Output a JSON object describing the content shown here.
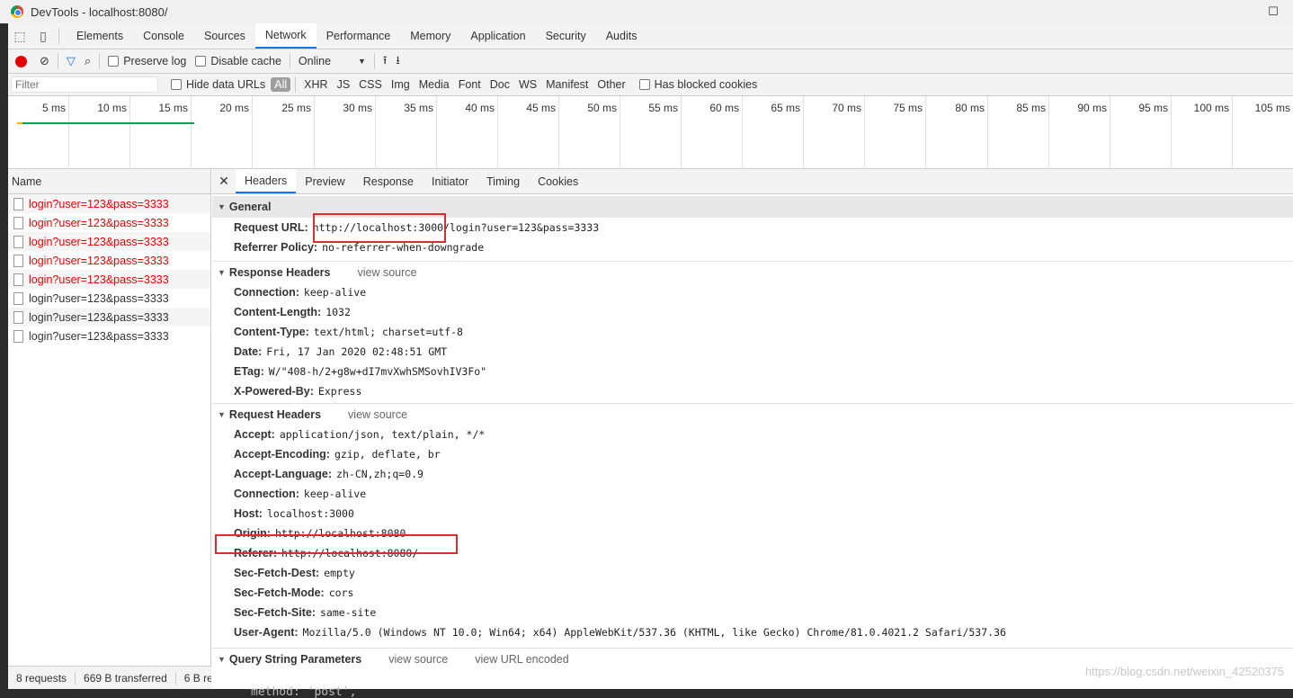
{
  "window": {
    "title": "DevTools - localhost:8080/",
    "maximize": "☐"
  },
  "main_tabs": [
    "Elements",
    "Console",
    "Sources",
    "Network",
    "Performance",
    "Memory",
    "Application",
    "Security",
    "Audits"
  ],
  "toolbar": {
    "preserve_log": "Preserve log",
    "disable_cache": "Disable cache",
    "throttle": "Online"
  },
  "filter_bar": {
    "placeholder": "Filter",
    "hide_data_urls": "Hide data URLs",
    "types": [
      "All",
      "XHR",
      "JS",
      "CSS",
      "Img",
      "Media",
      "Font",
      "Doc",
      "WS",
      "Manifest",
      "Other"
    ],
    "has_blocked_cookies": "Has blocked cookies"
  },
  "overview": {
    "ticks": [
      "5 ms",
      "10 ms",
      "15 ms",
      "20 ms",
      "25 ms",
      "30 ms",
      "35 ms",
      "40 ms",
      "45 ms",
      "50 ms",
      "55 ms",
      "60 ms",
      "65 ms",
      "70 ms",
      "75 ms",
      "80 ms",
      "85 ms",
      "90 ms",
      "95 ms",
      "100 ms",
      "105 ms"
    ]
  },
  "request_list": {
    "header": "Name",
    "rows": [
      {
        "name": "login?user=123&pass=3333",
        "failed": true
      },
      {
        "name": "login?user=123&pass=3333",
        "failed": true
      },
      {
        "name": "login?user=123&pass=3333",
        "failed": true
      },
      {
        "name": "login?user=123&pass=3333",
        "failed": true
      },
      {
        "name": "login?user=123&pass=3333",
        "failed": true
      },
      {
        "name": "login?user=123&pass=3333",
        "failed": false
      },
      {
        "name": "login?user=123&pass=3333",
        "failed": false
      },
      {
        "name": "login?user=123&pass=3333",
        "failed": false
      }
    ],
    "status": {
      "requests": "8 requests",
      "transferred": "669 B transferred",
      "resources": "6 B re"
    }
  },
  "detail_tabs": [
    "Headers",
    "Preview",
    "Response",
    "Initiator",
    "Timing",
    "Cookies"
  ],
  "general": {
    "title": "General",
    "rows": [
      {
        "k": "Request URL:",
        "v": "http://localhost:3000/login?user=123&pass=3333"
      },
      {
        "k": "Referrer Policy:",
        "v": "no-referrer-when-downgrade"
      }
    ]
  },
  "response_headers": {
    "title": "Response Headers",
    "view_source": "view source",
    "rows": [
      {
        "k": "Connection:",
        "v": "keep-alive"
      },
      {
        "k": "Content-Length:",
        "v": "1032"
      },
      {
        "k": "Content-Type:",
        "v": "text/html; charset=utf-8"
      },
      {
        "k": "Date:",
        "v": "Fri, 17 Jan 2020 02:48:51 GMT"
      },
      {
        "k": "ETag:",
        "v": "W/\"408-h/2+g8w+dI7mvXwhSMSovhIV3Fo\""
      },
      {
        "k": "X-Powered-By:",
        "v": "Express"
      }
    ]
  },
  "request_headers": {
    "title": "Request Headers",
    "view_source": "view source",
    "rows": [
      {
        "k": "Accept:",
        "v": "application/json, text/plain, */*"
      },
      {
        "k": "Accept-Encoding:",
        "v": "gzip, deflate, br"
      },
      {
        "k": "Accept-Language:",
        "v": "zh-CN,zh;q=0.9"
      },
      {
        "k": "Connection:",
        "v": "keep-alive"
      },
      {
        "k": "Host:",
        "v": "localhost:3000"
      },
      {
        "k": "Origin:",
        "v": "http://localhost:8080"
      },
      {
        "k": "Referer:",
        "v": "http://localhost:8080/"
      },
      {
        "k": "Sec-Fetch-Dest:",
        "v": "empty"
      },
      {
        "k": "Sec-Fetch-Mode:",
        "v": "cors"
      },
      {
        "k": "Sec-Fetch-Site:",
        "v": "same-site"
      },
      {
        "k": "User-Agent:",
        "v": "Mozilla/5.0 (Windows NT 10.0; Win64; x64) AppleWebKit/537.36 (KHTML, like Gecko) Chrome/81.0.4021.2 Safari/537.36"
      }
    ]
  },
  "query_string": {
    "title": "Query String Parameters",
    "view_source": "view source",
    "view_url_encoded": "view URL encoded"
  },
  "watermark": "https://blog.csdn.net/weixin_42520375",
  "behind_code": "method: 'post',"
}
